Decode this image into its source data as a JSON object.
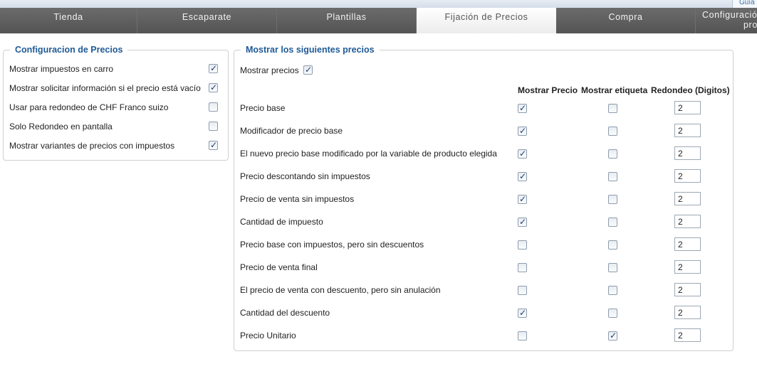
{
  "top_link": "Guía",
  "tabs": [
    {
      "label": "Tienda",
      "active": false
    },
    {
      "label": "Escaparate",
      "active": false
    },
    {
      "label": "Plantillas",
      "active": false
    },
    {
      "label": "Fijación de Precios",
      "active": true
    },
    {
      "label": "Compra",
      "active": false
    },
    {
      "label_line1": "Configuració",
      "label_line2": "pro",
      "active": false
    }
  ],
  "config": {
    "title": "Configuracion de Precios",
    "items": [
      {
        "label": "Mostrar impuestos en carro",
        "checked": true
      },
      {
        "label": "Mostrar solicitar información si el precio está vacío",
        "checked": true
      },
      {
        "label": "Usar para redondeo de CHF Franco suizo",
        "checked": false
      },
      {
        "label": "Solo Redondeo en pantalla",
        "checked": false
      },
      {
        "label": "Mostrar variantes de precios con impuestos",
        "checked": true
      }
    ]
  },
  "prices": {
    "title": "Mostrar los siguientes precios",
    "show_prices_label": "Mostrar precios",
    "show_prices_checked": true,
    "headers": {
      "show_price": "Mostrar Precio",
      "show_label": "Mostrar etiqueta",
      "rounding": "Redondeo (Digitos)"
    },
    "rows": [
      {
        "label": "Precio base",
        "show_price": true,
        "show_label": false,
        "rounding": "2"
      },
      {
        "label": "Modificador de precio base",
        "show_price": true,
        "show_label": false,
        "rounding": "2"
      },
      {
        "label": "El nuevo precio base modificado por la variable de producto elegida",
        "show_price": true,
        "show_label": false,
        "rounding": "2"
      },
      {
        "label": "Precio descontando sin impuestos",
        "show_price": true,
        "show_label": false,
        "rounding": "2"
      },
      {
        "label": "Precio de venta sin impuestos",
        "show_price": true,
        "show_label": false,
        "rounding": "2"
      },
      {
        "label": "Cantidad de impuesto",
        "show_price": true,
        "show_label": false,
        "rounding": "2"
      },
      {
        "label": "Precio base con impuestos, pero sin descuentos",
        "show_price": false,
        "show_label": false,
        "rounding": "2"
      },
      {
        "label": "Precio de venta final",
        "show_price": false,
        "show_label": false,
        "rounding": "2"
      },
      {
        "label": "El precio de venta con descuento, pero sin anulación",
        "show_price": false,
        "show_label": false,
        "rounding": "2"
      },
      {
        "label": "Cantidad del descuento",
        "show_price": true,
        "show_label": false,
        "rounding": "2"
      },
      {
        "label": "Precio Unitario",
        "show_price": false,
        "show_label": true,
        "rounding": "2"
      }
    ]
  }
}
